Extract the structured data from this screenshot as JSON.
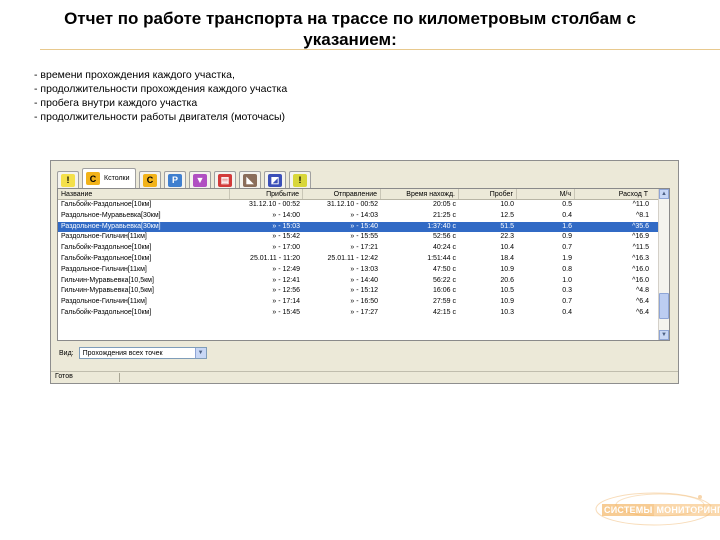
{
  "slide": {
    "title": "Отчет по работе транспорта на трассе по километровым столбам с указанием:",
    "bullets": [
      "- времени прохождения каждого участка,",
      "- продолжительности прохождения каждого участка",
      "- пробега внутри каждого участка",
      "- продолжительности работы двигателя (моточасы)"
    ]
  },
  "app": {
    "tabs": [
      {
        "icon": "warning-icon",
        "glyph": "!",
        "color": "#f4e04a"
      },
      {
        "icon": "c-report-icon",
        "glyph": "C",
        "color": "#f2b31a",
        "label": "Кстолки",
        "active": true
      },
      {
        "icon": "c-route-icon",
        "glyph": "C",
        "color": "#f2b31a"
      },
      {
        "icon": "parking-icon",
        "glyph": "P",
        "color": "#3f7fcf"
      },
      {
        "icon": "fuel-icon",
        "glyph": "▼",
        "color": "#b04fc2"
      },
      {
        "icon": "engine-icon",
        "glyph": "▤",
        "color": "#d23a3a"
      },
      {
        "icon": "tool-icon",
        "glyph": "◣",
        "color": "#8a6d5a"
      },
      {
        "icon": "chart-icon",
        "glyph": "◩",
        "color": "#3b4fb8"
      },
      {
        "icon": "info-icon",
        "glyph": "!",
        "color": "#d8d63a"
      }
    ],
    "grid": {
      "headers": [
        "Название",
        "Прибытие",
        "Отправление",
        "Время нахожд.",
        "Пробег",
        "М/ч",
        "Расход Т"
      ],
      "rows": [
        [
          "Гальбойк-Раздольное[10км]",
          "31.12.10 - 00:52",
          "31.12.10 - 00:52",
          "20:05 с",
          "10.0",
          "0.5",
          "^11.0"
        ],
        [
          "Раздольное-Муравьевка[30км]",
          "» - 14:00",
          "» - 14:03",
          "21:25 с",
          "12.5",
          "0.4",
          "^8.1"
        ],
        [
          "Раздольное-Муравьевка[30км]",
          "» - 15:03",
          "» - 15:40",
          "1:37:40 с",
          "51.5",
          "1.6",
          "^35.6"
        ],
        [
          "Раздольное-Гильчин[11км]",
          "» - 15:42",
          "» - 15:55",
          "52:56 с",
          "22.3",
          "0.9",
          "^16.9"
        ],
        [
          "Гальбойк-Раздольное[10км]",
          "» - 17:00",
          "» - 17:21",
          "40:24 с",
          "10.4",
          "0.7",
          "^11.5"
        ],
        [
          "Гальбойк-Раздольное[10км]",
          "25.01.11 - 11:20",
          "25.01.11 - 12:42",
          "1:51:44 с",
          "18.4",
          "1.9",
          "^16.3"
        ],
        [
          "Раздольное-Гильчин[11км]",
          "» - 12:49",
          "» - 13:03",
          "47:50 с",
          "10.9",
          "0.8",
          "^16.0"
        ],
        [
          "Гильчин-Муравьевка[10,5км]",
          "» - 12:41",
          "» - 14:40",
          "56:22 с",
          "20.6",
          "1.0",
          "^16.0"
        ],
        [
          "Гильчин-Муравьевка[10,5км]",
          "» - 12:56",
          "» - 15:12",
          "16:06 с",
          "10.5",
          "0.3",
          "^4.8"
        ],
        [
          "Раздольное-Гильчин[11км]",
          "» - 17:14",
          "» - 16:50",
          "27:59 с",
          "10.9",
          "0.7",
          "^6.4"
        ],
        [
          "Гальбойк-Раздольное[10км]",
          "» - 15:45",
          "» - 17:27",
          "42:15 с",
          "10.3",
          "0.4",
          "^6.4"
        ]
      ],
      "selected_row": 2
    },
    "view": {
      "label": "Вид:",
      "value": "Прохождения всех точек"
    },
    "status": {
      "text": "Готов"
    }
  },
  "logo": {
    "text_a": "СИСТЕМЫ",
    "text_b": "МОНИТОРИНГА"
  }
}
